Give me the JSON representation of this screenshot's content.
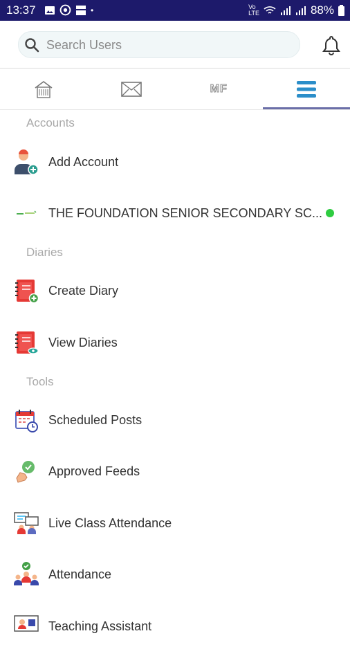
{
  "status_bar": {
    "time": "13:37",
    "battery": "88%"
  },
  "search": {
    "placeholder": "Search Users"
  },
  "tabs": [
    {
      "name": "home",
      "icon": "home-icon",
      "active": false
    },
    {
      "name": "messages",
      "icon": "mail-icon",
      "active": false
    },
    {
      "name": "mf",
      "label": "MF",
      "active": false
    },
    {
      "name": "menu",
      "icon": "menu-icon",
      "active": true
    }
  ],
  "sections": {
    "accounts": "Accounts",
    "diaries": "Diaries",
    "tools": "Tools"
  },
  "items": {
    "add_account": "Add Account",
    "school": "THE FOUNDATION SENIOR SECONDARY SC...",
    "create_diary": "Create Diary",
    "view_diaries": "View Diaries",
    "scheduled_posts": "Scheduled Posts",
    "approved_feeds": "Approved Feeds",
    "live_class_attendance": "Live Class Attendance",
    "attendance": "Attendance",
    "teaching_assistant": "Teaching Assistant"
  },
  "colors": {
    "status_bar": "#1d1a6b",
    "accent": "#6b6fa8",
    "online": "#2ecc40"
  }
}
